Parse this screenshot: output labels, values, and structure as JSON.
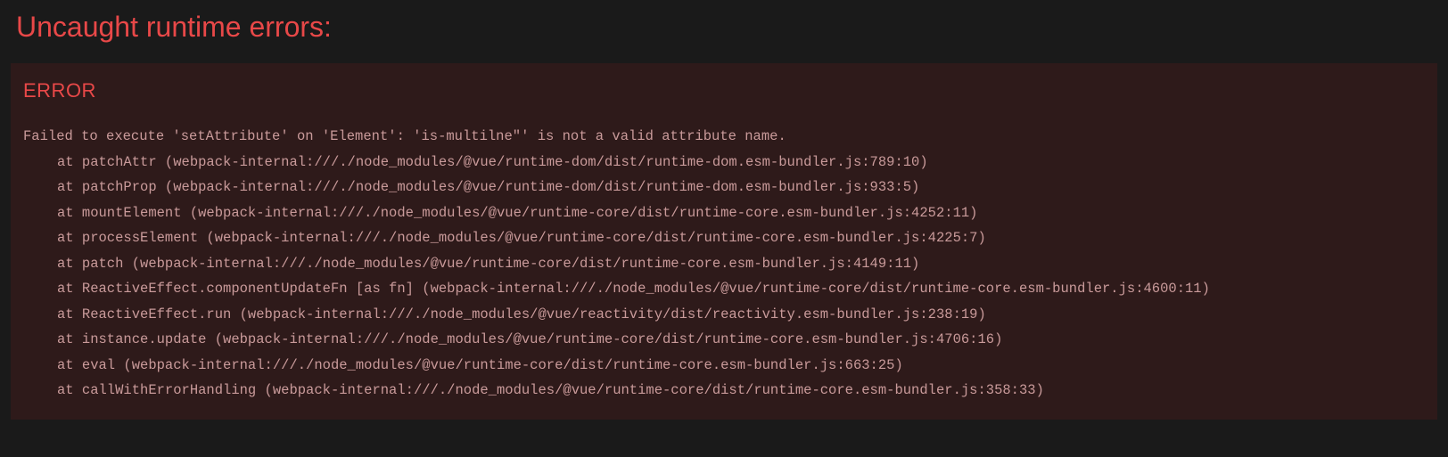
{
  "header": {
    "title": "Uncaught runtime errors:"
  },
  "error": {
    "label": "ERROR",
    "message": "Failed to execute 'setAttribute' on 'Element': 'is-multilne\"' is not a valid attribute name.",
    "stack": [
      "at patchAttr (webpack-internal:///./node_modules/@vue/runtime-dom/dist/runtime-dom.esm-bundler.js:789:10)",
      "at patchProp (webpack-internal:///./node_modules/@vue/runtime-dom/dist/runtime-dom.esm-bundler.js:933:5)",
      "at mountElement (webpack-internal:///./node_modules/@vue/runtime-core/dist/runtime-core.esm-bundler.js:4252:11)",
      "at processElement (webpack-internal:///./node_modules/@vue/runtime-core/dist/runtime-core.esm-bundler.js:4225:7)",
      "at patch (webpack-internal:///./node_modules/@vue/runtime-core/dist/runtime-core.esm-bundler.js:4149:11)",
      "at ReactiveEffect.componentUpdateFn [as fn] (webpack-internal:///./node_modules/@vue/runtime-core/dist/runtime-core.esm-bundler.js:4600:11)",
      "at ReactiveEffect.run (webpack-internal:///./node_modules/@vue/reactivity/dist/reactivity.esm-bundler.js:238:19)",
      "at instance.update (webpack-internal:///./node_modules/@vue/runtime-core/dist/runtime-core.esm-bundler.js:4706:16)",
      "at eval (webpack-internal:///./node_modules/@vue/runtime-core/dist/runtime-core.esm-bundler.js:663:25)",
      "at callWithErrorHandling (webpack-internal:///./node_modules/@vue/runtime-core/dist/runtime-core.esm-bundler.js:358:33)"
    ]
  }
}
